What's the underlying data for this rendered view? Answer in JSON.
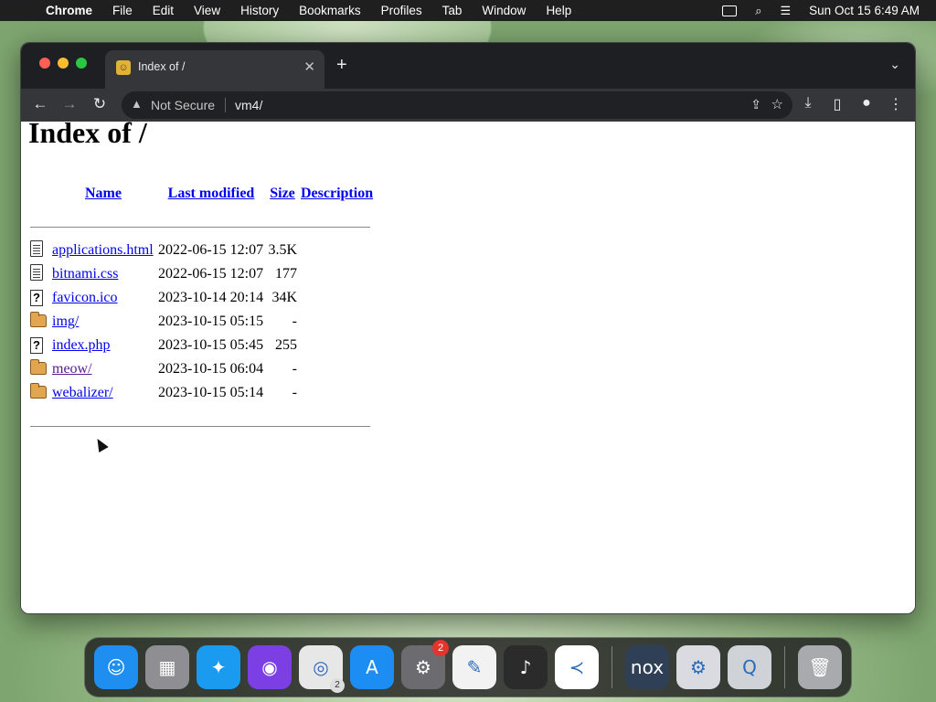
{
  "menubar": {
    "app_name": "Chrome",
    "items": [
      "File",
      "Edit",
      "View",
      "History",
      "Bookmarks",
      "Profiles",
      "Tab",
      "Window",
      "Help"
    ],
    "clock": "Sun Oct 15  6:49 AM"
  },
  "browser": {
    "tab_title": "Index of /",
    "address_security": "Not Secure",
    "address_url": "vm4/"
  },
  "page": {
    "heading": "Index of /",
    "columns": {
      "name": "Name",
      "modified": "Last modified",
      "size": "Size",
      "description": "Description"
    },
    "rows": [
      {
        "icon": "document-icon",
        "name": "applications.html",
        "modified": "2022-06-15 12:07",
        "size": "3.5K",
        "visited": false
      },
      {
        "icon": "document-icon",
        "name": "bitnami.css",
        "modified": "2022-06-15 12:07",
        "size": "177",
        "visited": false
      },
      {
        "icon": "unknown-file-icon",
        "name": "favicon.ico",
        "modified": "2023-10-14 20:14",
        "size": "34K",
        "visited": false
      },
      {
        "icon": "folder-icon",
        "name": "img/",
        "modified": "2023-10-15 05:15",
        "size": "-",
        "visited": false
      },
      {
        "icon": "unknown-file-icon",
        "name": "index.php",
        "modified": "2023-10-15 05:45",
        "size": "255",
        "visited": false
      },
      {
        "icon": "folder-icon",
        "name": "meow/",
        "modified": "2023-10-15 06:04",
        "size": "-",
        "visited": true
      },
      {
        "icon": "folder-icon",
        "name": "webalizer/",
        "modified": "2023-10-15 05:14",
        "size": "-",
        "visited": false
      }
    ]
  },
  "dock": {
    "apps": [
      {
        "name": "finder-icon",
        "color": "#1e8ef0"
      },
      {
        "name": "launchpad-icon",
        "color": "#8e8e93"
      },
      {
        "name": "safari-icon",
        "color": "#1a9bf0"
      },
      {
        "name": "firefox-icon",
        "color": "#7b3fe4"
      },
      {
        "name": "chrome-icon",
        "color": "#e7e7e7",
        "badge": "2"
      },
      {
        "name": "app-store-icon",
        "color": "#1c8df3"
      },
      {
        "name": "system-settings-icon",
        "color": "#6c6c70",
        "badge": "2"
      },
      {
        "name": "textedit-icon",
        "color": "#f2f2f2"
      },
      {
        "name": "garageband-icon",
        "color": "#2b2b2b"
      },
      {
        "name": "vscode-icon",
        "color": "#ffffff"
      },
      {
        "name": "nox-icon",
        "color": "#2f3f56"
      },
      {
        "name": "preferences-gear-icon",
        "color": "#d9dbe0"
      },
      {
        "name": "quicktime-icon",
        "color": "#cfd3d8"
      },
      {
        "name": "trash-icon",
        "color": "#a8aaad"
      }
    ]
  }
}
